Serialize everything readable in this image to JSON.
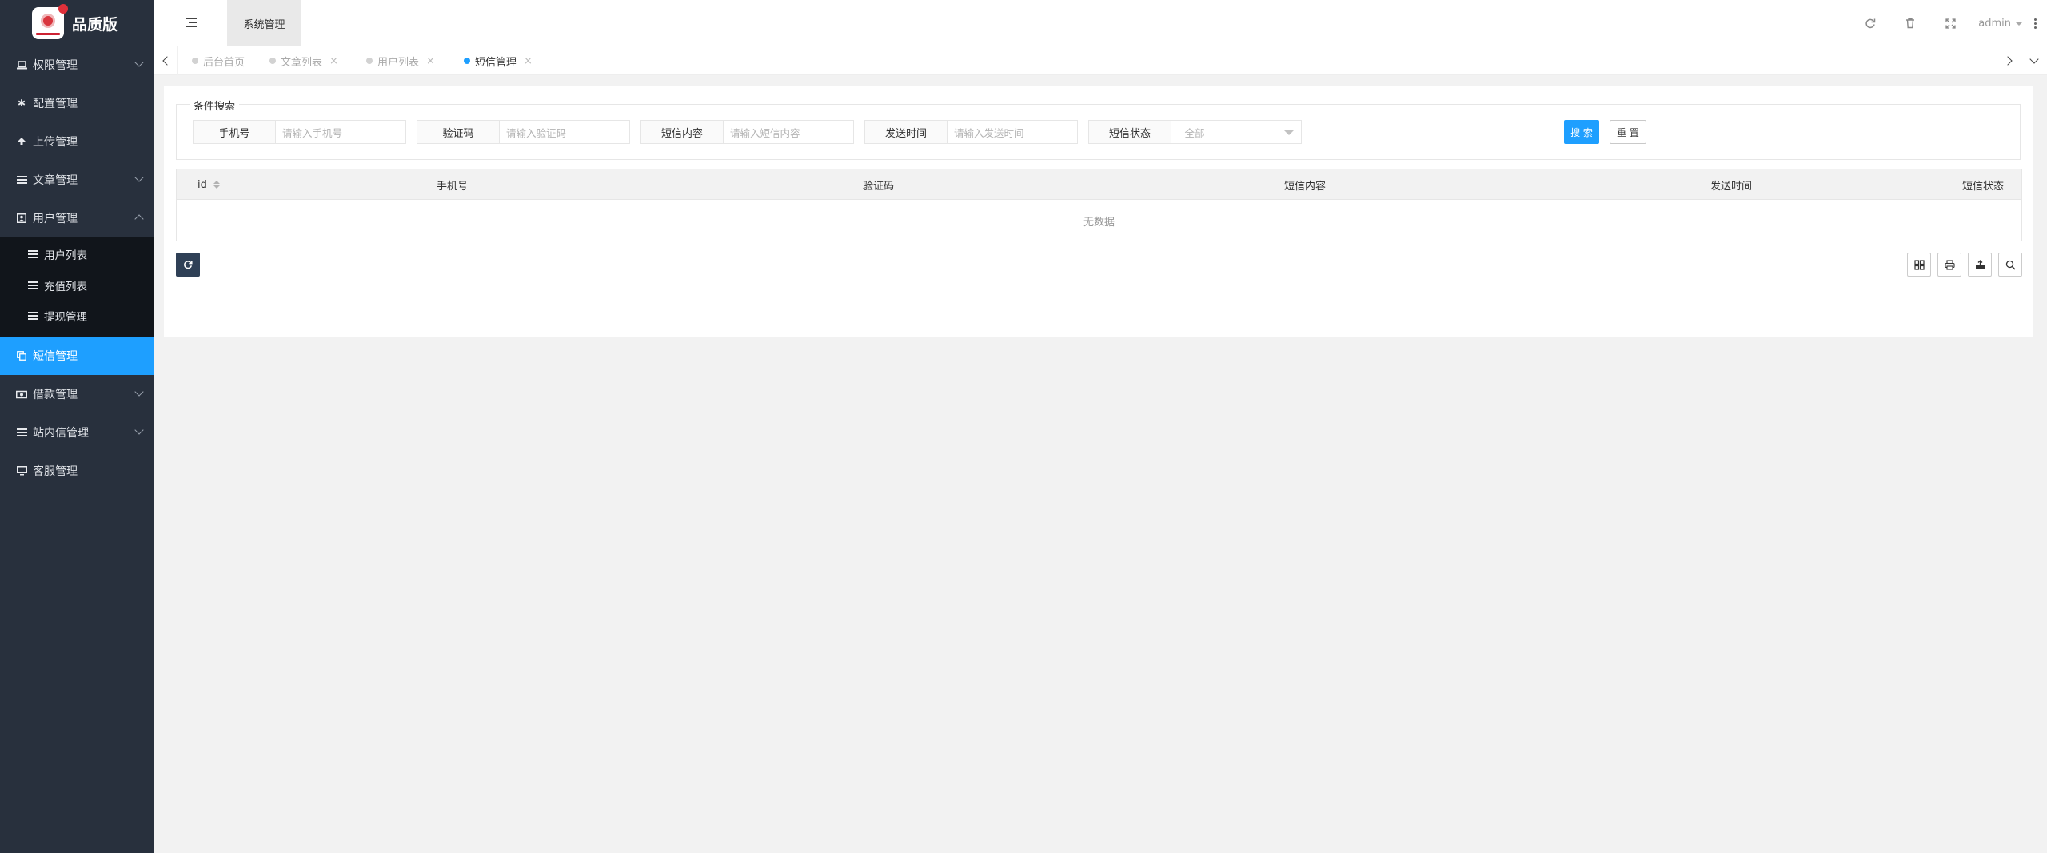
{
  "brand": {
    "name": "品质版"
  },
  "sidebar": {
    "items": [
      {
        "label": "权限管理",
        "icon": "laptop-icon"
      },
      {
        "label": "配置管理",
        "icon": "gear-icon"
      },
      {
        "label": "上传管理",
        "icon": "upload-icon"
      },
      {
        "label": "文章管理",
        "icon": "list-icon"
      },
      {
        "label": "用户管理",
        "icon": "user-icon"
      },
      {
        "label": "短信管理",
        "icon": "copy-icon"
      },
      {
        "label": "借款管理",
        "icon": "money-icon"
      },
      {
        "label": "站内信管理",
        "icon": "list-icon"
      },
      {
        "label": "客服管理",
        "icon": "desktop-icon"
      }
    ],
    "sub_items": [
      {
        "label": "用户列表"
      },
      {
        "label": "充值列表"
      },
      {
        "label": "提现管理"
      }
    ]
  },
  "header": {
    "system_tab": "系统管理",
    "user": "admin"
  },
  "tabs": [
    {
      "label": "后台首页"
    },
    {
      "label": "文章列表"
    },
    {
      "label": "用户列表"
    },
    {
      "label": "短信管理"
    }
  ],
  "search": {
    "legend": "条件搜索",
    "fields": [
      {
        "label": "手机号",
        "placeholder": "请输入手机号"
      },
      {
        "label": "验证码",
        "placeholder": "请输入验证码"
      },
      {
        "label": "短信内容",
        "placeholder": "请输入短信内容"
      },
      {
        "label": "发送时间",
        "placeholder": "请输入发送时间"
      },
      {
        "label": "短信状态",
        "value": "- 全部 -"
      }
    ],
    "search_btn": "搜 索",
    "reset_btn": "重 置"
  },
  "table": {
    "columns": [
      "id",
      "手机号",
      "验证码",
      "短信内容",
      "发送时间",
      "短信状态"
    ],
    "empty_text": "无数据"
  },
  "colors": {
    "sidebar_bg": "#28303d",
    "accent": "#1e9fff",
    "submenu_bg": "#11151b"
  }
}
